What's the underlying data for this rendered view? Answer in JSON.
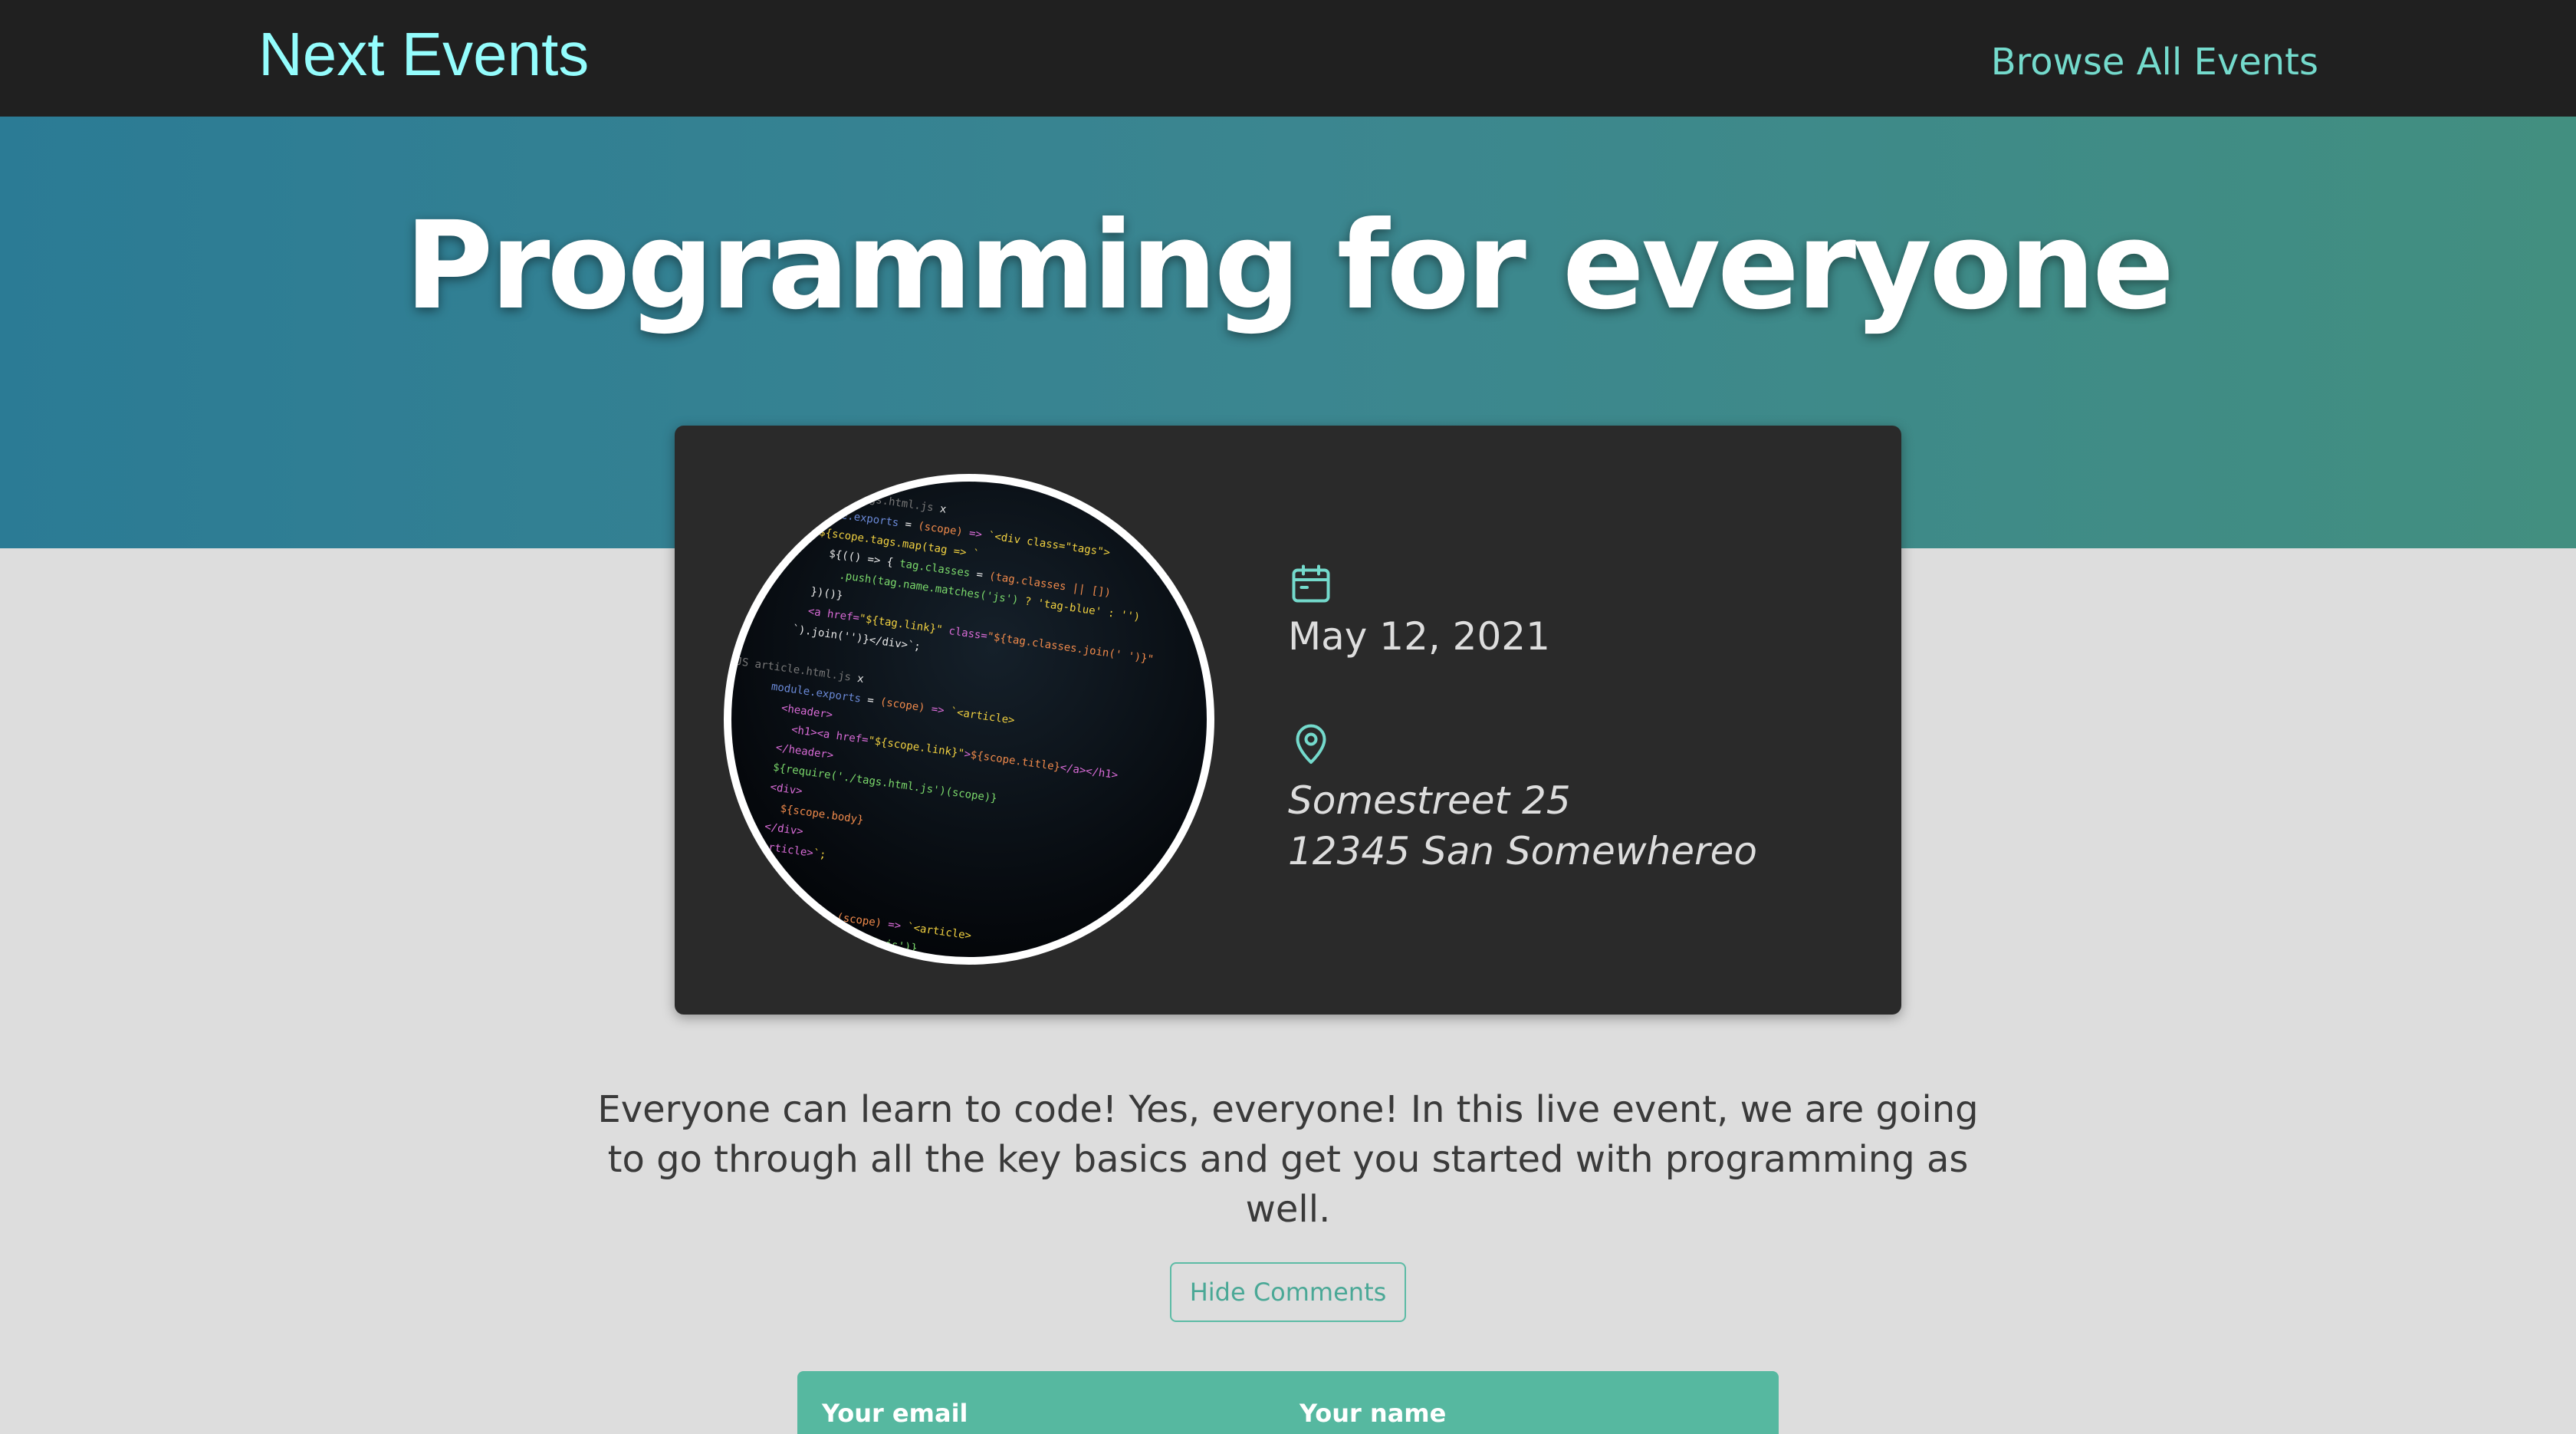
{
  "header": {
    "logo": "Next Events",
    "nav_link": "Browse All Events"
  },
  "hero": {
    "title": "Programming for everyone"
  },
  "event": {
    "date": "May 12, 2021",
    "address_line1": "Somestreet 25",
    "address_line2": "12345 San Somewhereo",
    "date_icon": "calendar-icon",
    "address_icon": "map-pin-icon",
    "image": "code-screen-photo"
  },
  "description": "Everyone can learn to code! Yes, everyone! In this live event, we are going to go through all the key basics and get you started with programming as well.",
  "comments": {
    "toggle_label": "Hide Comments",
    "email_label": "Your email",
    "name_label": "Your name"
  },
  "colors": {
    "topbar": "#202020",
    "logo": "#94fdfd",
    "accent": "#74dacc",
    "card": "#2a2a2a",
    "form": "#56b8a0",
    "page_bg": "#dddddd"
  }
}
